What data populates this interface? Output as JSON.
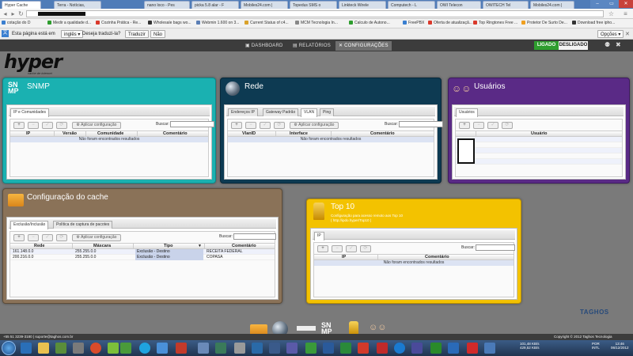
{
  "browser": {
    "tabs": [
      {
        "label": "Hyper Cache",
        "active": true
      },
      {
        "label": "Terra - Notícias,",
        "active": false
      },
      {
        "label": "nano loco - Pes",
        "active": false
      },
      {
        "label": "picka 5.8 alar - F",
        "active": false
      },
      {
        "label": "Mobiles24.com |",
        "active": false
      },
      {
        "label": "Topedus SMS o",
        "active": false
      },
      {
        "label": "Linkteck Wirele",
        "active": false
      },
      {
        "label": "Computech - L",
        "active": false
      },
      {
        "label": "OWI Telecon",
        "active": false
      },
      {
        "label": "OWITECH Tel",
        "active": false
      },
      {
        "label": "Mobiles24.com |",
        "active": false
      }
    ],
    "window_controls": [
      "–",
      "▭",
      "✕"
    ],
    "bookmarks": [
      {
        "label": "cotação do D",
        "color": "#3a7fd0"
      },
      {
        "label": "Medir a qualidade d...",
        "color": "#2e9d2e"
      },
      {
        "label": "Cozinha Prática - Re...",
        "color": "#d9392b"
      },
      {
        "label": "Wholesale bags wo...",
        "color": "#333"
      },
      {
        "label": "Webmin 1.600 on 3...",
        "color": "#5b7fb5"
      },
      {
        "label": "Current Status of c4...",
        "color": "#d9a22b"
      },
      {
        "label": "MCM Tecnologia In...",
        "color": "#888"
      },
      {
        "label": "Calculo de Autono...",
        "color": "#2e9d2e"
      },
      {
        "label": "FreePBX",
        "color": "#3a7fd0"
      },
      {
        "label": "Oferta de atualizaçã...",
        "color": "#d9392b"
      },
      {
        "label": "Top Ringtones Free ...",
        "color": "#d9392b"
      },
      {
        "label": "Protetor De Surto De...",
        "color": "#f0a020"
      },
      {
        "label": "Download free ipho...",
        "color": "#333"
      }
    ]
  },
  "translate_bar": {
    "prefix": "Esta página está em",
    "language": "inglês",
    "question": "Deseja traduzi-la?",
    "translate_btn": "Traduzir",
    "no_btn": "Não",
    "options_btn": "Opções"
  },
  "nav": {
    "items": [
      {
        "label": "DASHBOARD",
        "active": false
      },
      {
        "label": "RELATÓRIOS",
        "active": false
      },
      {
        "label": "CONFIGURAÇÕES",
        "active": true
      }
    ],
    "on_label": "LIGADO",
    "off_label": "DESLIGADO"
  },
  "logo": {
    "text": "hyper",
    "subtitle": "cache de internet"
  },
  "colors": {
    "snmp": "#1ab1b1",
    "rede": "#0d3a52",
    "usuarios": "#5a2a86",
    "cache": "#8a7258",
    "top10": "#f3c200"
  },
  "panels": {
    "snmp": {
      "title": "SNMP",
      "icon": "snmp-icon",
      "tabs": [
        "IP e Comunidades"
      ],
      "apply": "Aplicar configuração",
      "search": "Buscar:",
      "columns": [
        "IP",
        "Versão",
        "Comunidade",
        "Comentário"
      ],
      "empty": "Não foram encontrados resultados"
    },
    "rede": {
      "title": "Rede",
      "icon": "globe-icon",
      "tabs": [
        "Endereços IP",
        "Gateway Padrão",
        "VLAN",
        "Ping"
      ],
      "active_tab": 2,
      "apply": "Aplicar configuração",
      "search": "Buscar:",
      "columns": [
        "VlanID",
        "Interface",
        "Comentário"
      ],
      "empty": "Não foram encontrados resultados"
    },
    "usuarios": {
      "title": "Usuários",
      "icon": "users-icon",
      "tabs": [
        "Usuários"
      ],
      "columns": [
        "Usuário"
      ]
    },
    "cache": {
      "title": "Configuração do cache",
      "icon": "folder-icon",
      "tabs": [
        "Exclusão/Inclusão",
        "Política de captura de pacotes"
      ],
      "apply": "Aplicar configuração",
      "search": "Buscar:",
      "columns": [
        "Rede",
        "Máscara",
        "Tipo",
        "Comentário"
      ],
      "rows": [
        {
          "rede": "161.148.0.0",
          "mascara": "255.255.0.0",
          "tipo": "Exclusão - Destino",
          "comentario": "RECEITA FEDERAL"
        },
        {
          "rede": "200.216.0.0",
          "mascara": "255.255.0.0",
          "tipo": "Exclusão - Destino",
          "comentario": "COPASA"
        }
      ]
    },
    "top10": {
      "title": "Top 10",
      "icon": "trophy-icon",
      "desc1": "Configuração para acesso remoto aos Top 10",
      "desc2": "( http://ipdo.hyper/Top10 )",
      "tabs": [
        "IP"
      ],
      "search": "Buscar:",
      "columns": [
        "IP",
        "Comentário"
      ],
      "empty": "Não foram encontrados resultados"
    }
  },
  "brand": "TAGHOS",
  "footer": {
    "contact": "+55 51 3239-3180 | suporte@taghos.com.br",
    "copyright": "Copyright © 2012 Taghos Tecnologia"
  },
  "taskbar": {
    "lang": "POR\nINTL",
    "time": "13:46",
    "date": "06/12/2012",
    "net": "101,48 KB/s\n429,52 KB/s"
  }
}
